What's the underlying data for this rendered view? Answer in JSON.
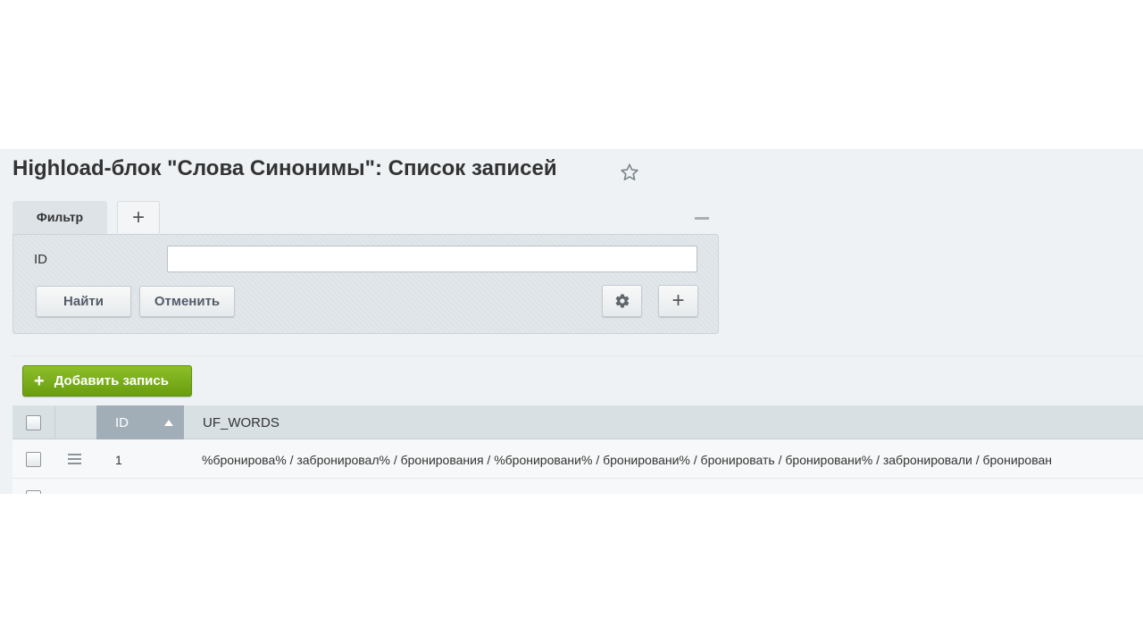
{
  "page": {
    "title": "Highload-блок \"Слова Синонимы\": Список записей"
  },
  "filter": {
    "tab_label": "Фильтр",
    "add_tab_label": "+",
    "field_label": "ID",
    "id_value": "",
    "find_button": "Найти",
    "cancel_button": "Отменить",
    "add_field_label": "+"
  },
  "list": {
    "add_record_label": "Добавить запись",
    "add_record_plus": "+",
    "columns": [
      "ID",
      "UF_WORDS"
    ],
    "sort": {
      "column": "ID",
      "direction": "asc"
    },
    "rows": [
      {
        "id": "1",
        "words": "%бронирова% / забронировал% / бронирования / %бронировани% / бронировани% / бронировать / бронировани% / забронировали / бронирован"
      }
    ]
  },
  "colors": {
    "accent_green": "#7aad1c",
    "header_active": "#a1aeb7",
    "panel_bg": "#eef2f4"
  },
  "icons": [
    "star-icon",
    "plus-icon",
    "minimize-icon",
    "gear-icon",
    "sort-asc-icon",
    "row-menu-icon"
  ]
}
